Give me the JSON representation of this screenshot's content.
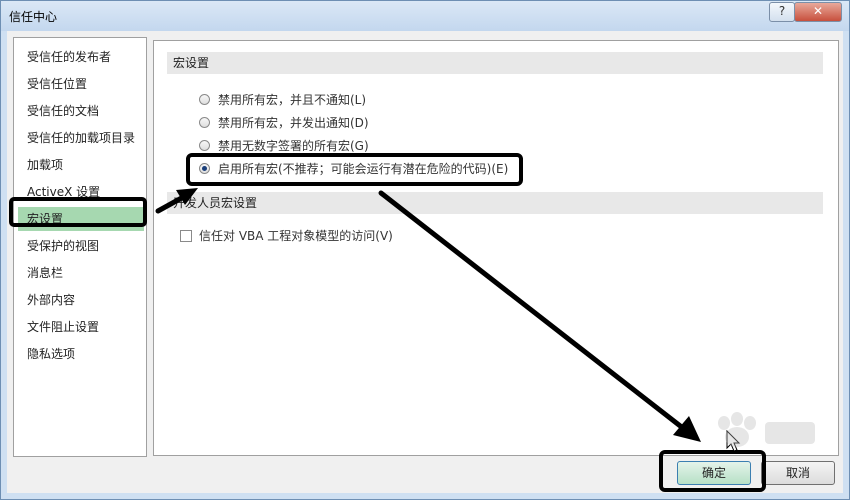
{
  "window": {
    "title": "信任中心",
    "help_label": "?",
    "close_label": "✕"
  },
  "sidebar": {
    "items": [
      {
        "label": "受信任的发布者"
      },
      {
        "label": "受信任位置"
      },
      {
        "label": "受信任的文档"
      },
      {
        "label": "受信任的加载项目录"
      },
      {
        "label": "加载项"
      },
      {
        "label": "ActiveX 设置"
      },
      {
        "label": "宏设置",
        "selected": true
      },
      {
        "label": "受保护的视图"
      },
      {
        "label": "消息栏"
      },
      {
        "label": "外部内容"
      },
      {
        "label": "文件阻止设置"
      },
      {
        "label": "隐私选项"
      }
    ]
  },
  "macro_settings": {
    "header": "宏设置",
    "options": [
      {
        "label": "禁用所有宏，并且不通知(L)",
        "checked": false
      },
      {
        "label": "禁用所有宏，并发出通知(D)",
        "checked": false
      },
      {
        "label": "禁用无数字签署的所有宏(G)",
        "checked": false
      },
      {
        "label": "启用所有宏(不推荐；可能会运行有潜在危险的代码)(E)",
        "checked": true
      }
    ]
  },
  "developer_settings": {
    "header": "开发人员宏设置",
    "vba_trust_label": "信任对 VBA 工程对象模型的访问(V)",
    "vba_trust_checked": false
  },
  "buttons": {
    "ok_label": "确定",
    "cancel_label": "取消"
  },
  "colors": {
    "selected_item": "#a6d8b0",
    "annotation": "#000000",
    "ok_button": "#b7e0c6"
  }
}
